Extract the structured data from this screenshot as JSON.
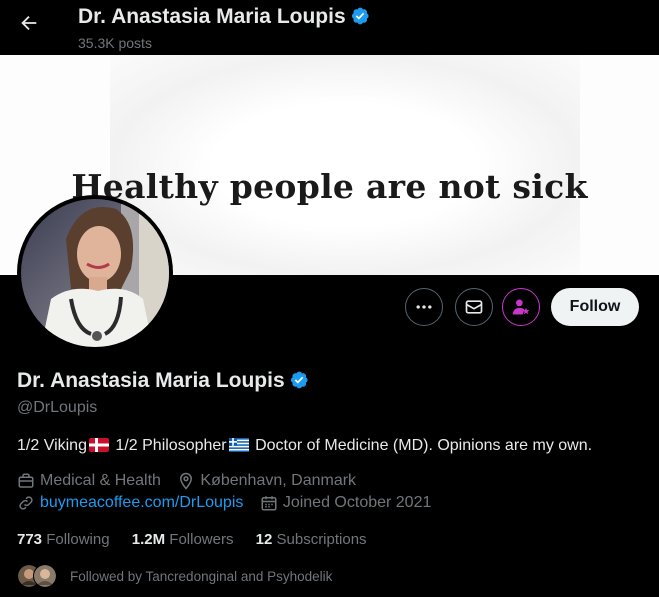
{
  "header": {
    "name": "Dr. Anastasia Maria Loupis",
    "posts": "35.3K posts"
  },
  "banner": {
    "text": "Healthy people are not sick"
  },
  "actions": {
    "follow_label": "Follow"
  },
  "profile": {
    "name": "Dr. Anastasia Maria Loupis",
    "handle": "@DrLoupis",
    "bio_part1": "1/2 Viking",
    "bio_part2": " 1/2 Philosopher",
    "bio_part3": " Doctor of Medicine (MD). Opinions are my own.",
    "category": "Medical & Health",
    "location": "København, Danmark",
    "website": "buymeacoffee.com/DrLoupis",
    "joined": "Joined October 2021"
  },
  "stats": {
    "following_count": "773",
    "following_label": "Following",
    "followers_count": "1.2M",
    "followers_label": "Followers",
    "subscriptions_count": "12",
    "subscriptions_label": "Subscriptions"
  },
  "followed_by": "Followed by Tancredonginal and Psyhodelik",
  "colors": {
    "accent": "#1d9bf0",
    "subscribe_icon": "#c936cc",
    "background": "#000000"
  },
  "icons": [
    "back-arrow-icon",
    "verified-icon",
    "more-icon",
    "mail-icon",
    "subscribe-icon",
    "briefcase-icon",
    "location-icon",
    "link-icon",
    "calendar-icon"
  ]
}
